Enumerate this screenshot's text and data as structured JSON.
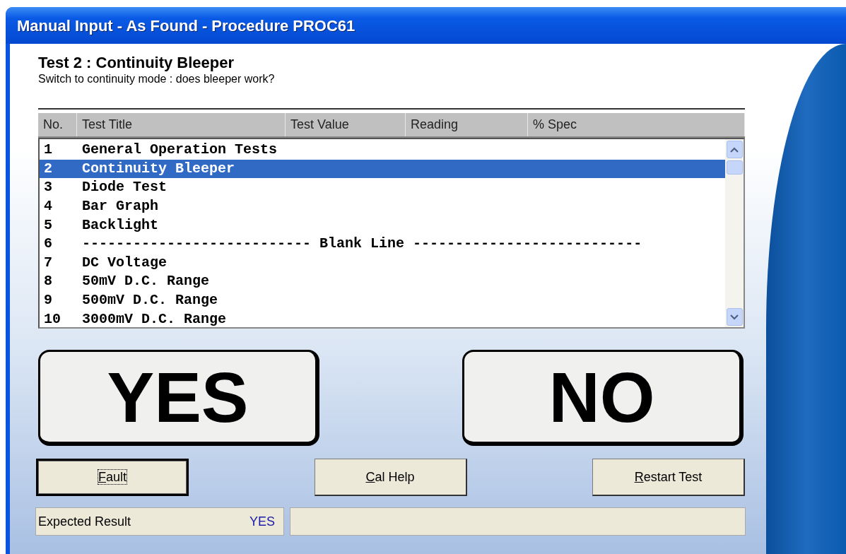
{
  "window": {
    "title": "Manual Input - As Found - Procedure PROC61"
  },
  "test": {
    "heading": "Test 2 : Continuity Bleeper",
    "instruction": "Switch to continuity mode : does bleeper work?"
  },
  "table": {
    "columns": [
      "No.",
      "Test Title",
      "Test Value",
      "Reading",
      "% Spec"
    ],
    "rows": [
      {
        "no": "1",
        "title": "General Operation Tests",
        "selected": false
      },
      {
        "no": "2",
        "title": "Continuity Bleeper",
        "selected": true
      },
      {
        "no": "3",
        "title": "Diode Test",
        "selected": false
      },
      {
        "no": "4",
        "title": "Bar Graph",
        "selected": false
      },
      {
        "no": "5",
        "title": "Backlight",
        "selected": false
      },
      {
        "no": "6",
        "title": "--------------------------- Blank Line ---------------------------",
        "selected": false
      },
      {
        "no": "7",
        "title": "DC Voltage",
        "selected": false
      },
      {
        "no": "8",
        "title": "50mV D.C. Range",
        "selected": false
      },
      {
        "no": "9",
        "title": "500mV D.C. Range",
        "selected": false
      },
      {
        "no": "10",
        "title": "3000mV D.C. Range",
        "selected": false
      }
    ]
  },
  "answers": [
    "YES",
    "NO"
  ],
  "buttons": [
    {
      "label": "Fault",
      "focused": true
    },
    {
      "label": "Cal Help",
      "focused": false
    },
    {
      "label": "Restart Test",
      "focused": false
    }
  ],
  "status_bar": {
    "label": "Expected Result",
    "value": "YES"
  }
}
